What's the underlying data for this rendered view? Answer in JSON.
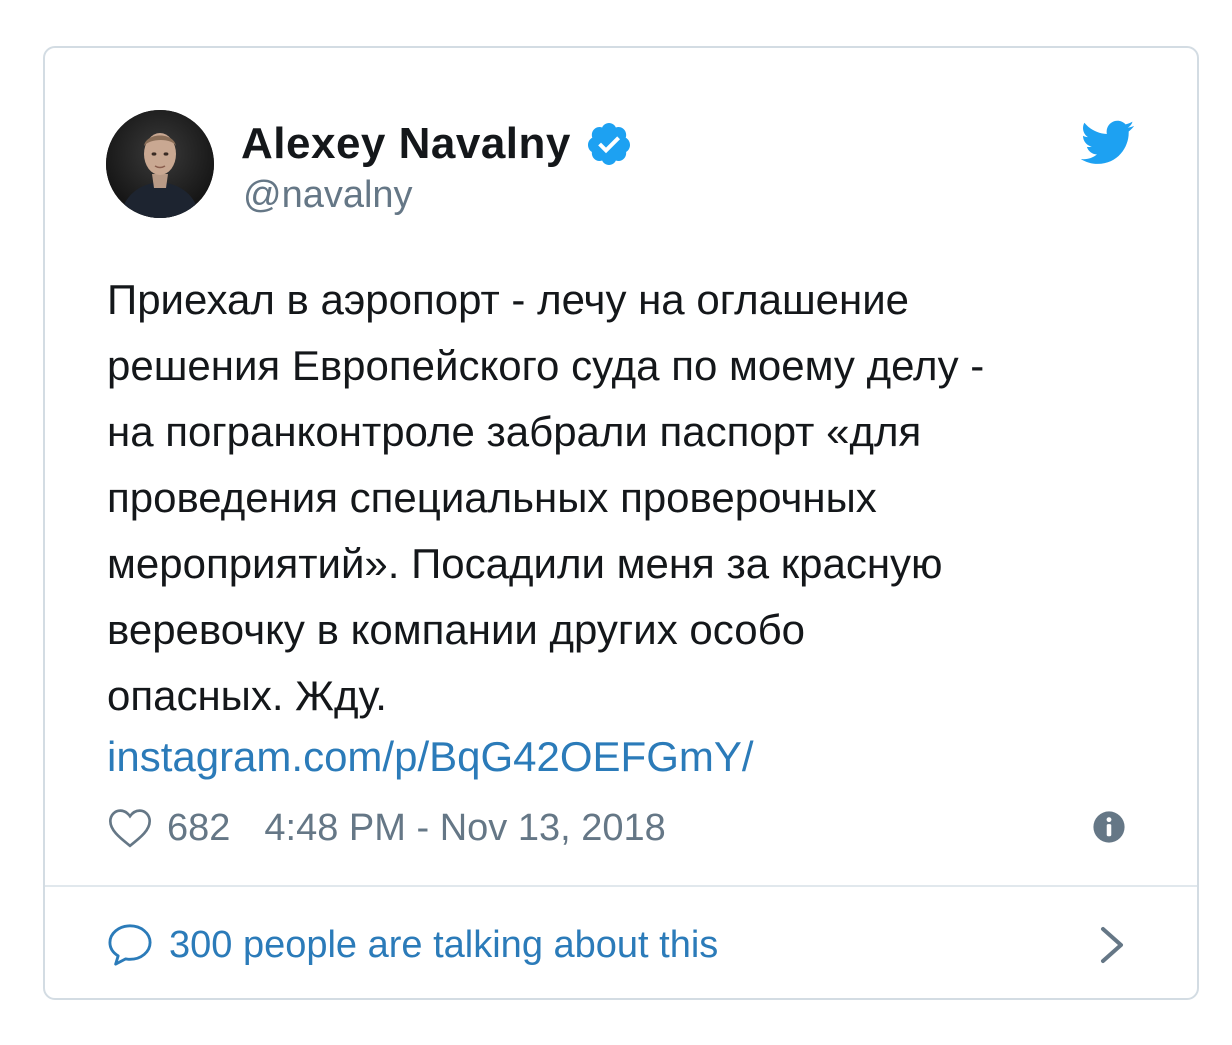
{
  "author": {
    "display_name": "Alexey Navalny",
    "handle": "@navalny",
    "avatar_icon": "profile-photo",
    "verified_icon": "verified-badge-icon"
  },
  "brand": {
    "icon": "twitter-bird-icon",
    "color": "#1da1f2"
  },
  "tweet": {
    "text": "Приехал в аэропорт - лечу на оглашение\nрешения Европейского суда по моему делу -\nна погранконтроле забрали паспорт «для\nпроведения специальных проверочных\nмероприятий». Посадили меня за красную\nверевочку в компании других особо\nопасных. Жду.",
    "link": "instagram.com/p/BqG42OEFGmY/"
  },
  "meta": {
    "likes": "682",
    "timestamp": "4:48 PM - Nov 13, 2018"
  },
  "footer": {
    "discussion_label": "300 people are talking about this"
  },
  "colors": {
    "text": "#14171a",
    "secondary": "#657786",
    "link": "#2b7bb9",
    "border": "#d3dce3"
  }
}
